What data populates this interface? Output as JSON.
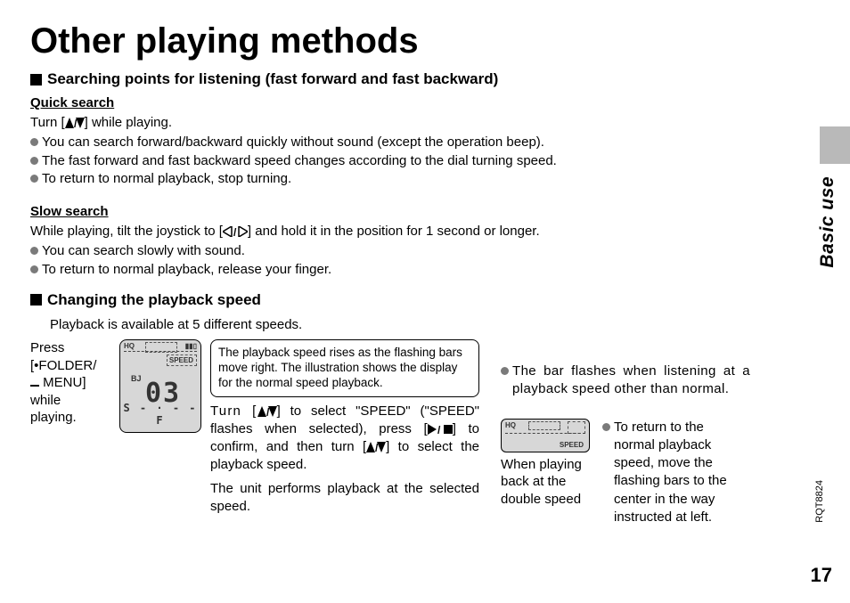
{
  "title": "Other playing methods",
  "section1": {
    "heading": "Searching points for listening (fast forward and fast backward)",
    "quick": {
      "title": "Quick search",
      "line": "Turn [",
      "line_after": "] while playing.",
      "bullets": [
        "You can search forward/backward quickly without sound (except the operation beep).",
        "The fast forward and fast backward speed changes according to the dial turning speed.",
        "To return to normal playback, stop turning."
      ]
    },
    "slow": {
      "title": "Slow search",
      "line_a": "While playing, tilt the joystick to [",
      "line_b": "] and hold it in the position for 1 second or longer.",
      "bullets": [
        "You can search slowly with sound.",
        "To return to normal playback, release your finger."
      ]
    }
  },
  "section2": {
    "heading": "Changing the playback speed",
    "sub": "Playback is available at 5 different speeds.",
    "left": {
      "l1": "Press",
      "l2": "[•FOLDER/",
      "l3": "MENU]",
      "l4": "while",
      "l5": "playing."
    },
    "lcd": {
      "hq": "HQ",
      "speed": "SPEED",
      "bj": "BJ",
      "num": "03",
      "bottom": "S - · - - F"
    },
    "tip": "The playback speed rises as the flashing bars move right. The illustration shows the display for the normal speed playback.",
    "mid_a": "Turn [",
    "mid_b": "] to select \"SPEED\" (\"SPEED\" flashes when selected), press [",
    "mid_c": "] to confirm, and then turn [",
    "mid_d": "] to select the playback speed.",
    "mid_e": "The unit performs playback at the selected speed.",
    "right1": "The bar flashes when listening at a playback speed other than normal.",
    "double_caption": "When playing back at the double speed",
    "small_lcd": {
      "hq": "HQ",
      "speed": "SPEED"
    },
    "right2": "To return to the normal playback speed, move the flashing bars to the center in the way instructed at left."
  },
  "side": {
    "label": "Basic use",
    "code": "RQT8824",
    "page": "17"
  }
}
